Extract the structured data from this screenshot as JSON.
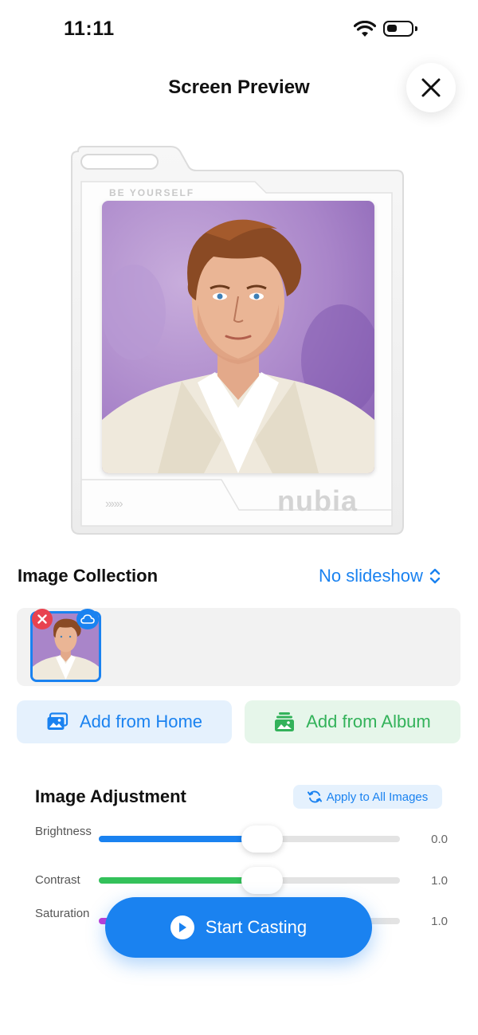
{
  "status_bar": {
    "time": "11:11"
  },
  "header": {
    "title": "Screen Preview"
  },
  "preview": {
    "frame_top_text": "BE YOURSELF",
    "frame_arrows": "»»»",
    "brand": "nubia"
  },
  "collection": {
    "title": "Image Collection",
    "slideshow_label": "No slideshow",
    "add_home_label": "Add from Home",
    "add_album_label": "Add from Album"
  },
  "adjustment": {
    "title": "Image Adjustment",
    "apply_label": "Apply to All Images",
    "sliders": [
      {
        "label": "Brightness",
        "value": "0.0",
        "fraction": 0.5,
        "color": "#1a82f0"
      },
      {
        "label": "Contrast",
        "value": "1.0",
        "fraction": 0.5,
        "color": "#33c15a"
      },
      {
        "label": "Saturation",
        "value": "1.0",
        "fraction": 0.5,
        "color": "#c23ad6"
      }
    ]
  },
  "cast_button": {
    "label": "Start Casting"
  },
  "colors": {
    "accent": "#1a82f0",
    "green": "#33b25a",
    "danger": "#e8424f"
  }
}
